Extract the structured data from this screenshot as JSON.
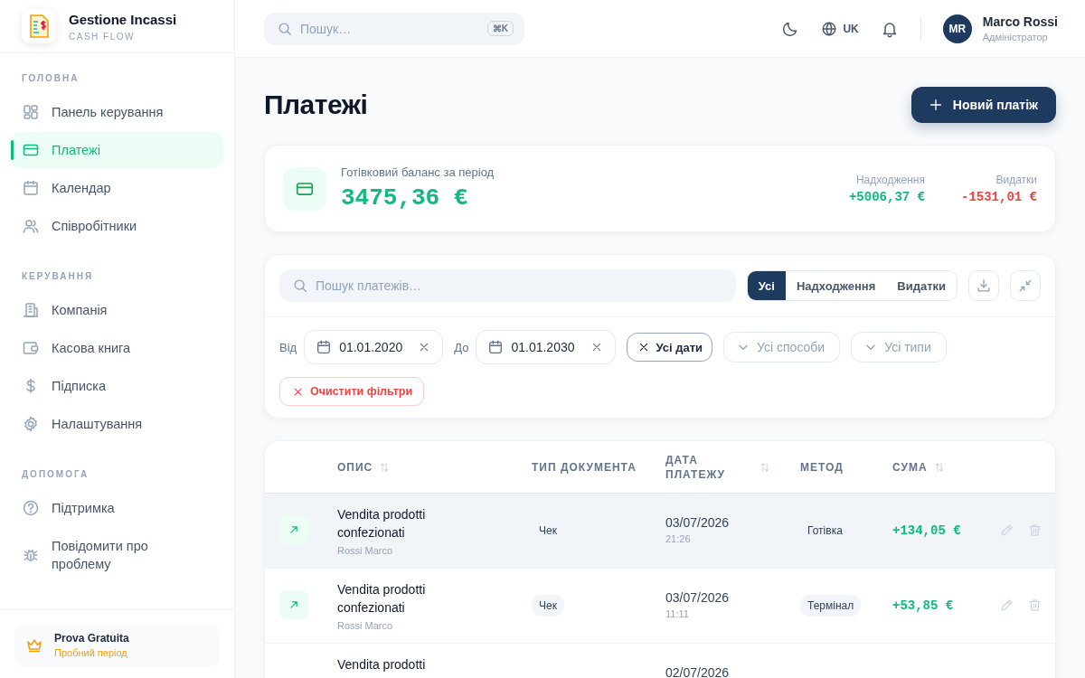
{
  "app": {
    "name": "Gestione Incassi",
    "tagline": "CASH FLOW"
  },
  "sidebar": {
    "sections": [
      {
        "title": "ГОЛОВНА",
        "items": [
          {
            "label": "Панель керування",
            "selected": false
          },
          {
            "label": "Платежі",
            "selected": true
          },
          {
            "label": "Календар",
            "selected": false
          },
          {
            "label": "Співробітники",
            "selected": false
          }
        ]
      },
      {
        "title": "КЕРУВАННЯ",
        "items": [
          {
            "label": "Компанія",
            "selected": false
          },
          {
            "label": "Касова книга",
            "selected": false
          },
          {
            "label": "Підписка",
            "selected": false
          },
          {
            "label": "Налаштування",
            "selected": false
          }
        ]
      },
      {
        "title": "ДОПОМОГА",
        "items": [
          {
            "label": "Підтримка",
            "selected": false
          },
          {
            "label": "Повідомити про проблему",
            "selected": false
          }
        ]
      }
    ],
    "trial": {
      "title": "Prova Gratuita",
      "subtitle": "Пробний період"
    }
  },
  "header": {
    "search": {
      "placeholder": "Пошук…",
      "shortcut": "⌘K"
    },
    "language": "UK",
    "user": {
      "initials": "MR",
      "name": "Marco Rossi",
      "role": "Адміністратор"
    }
  },
  "page": {
    "title": "Платежі",
    "new_button": "Новий платіж"
  },
  "balance": {
    "label": "Готівковий баланс за період",
    "value": "3475,36 €",
    "income_label": "Надходження",
    "income": "+5006,37 €",
    "expense_label": "Видатки",
    "expense": "-1531,01 €"
  },
  "filters": {
    "search": {
      "placeholder": "Пошук платежів…"
    },
    "segments": [
      {
        "label": "Усі",
        "selected": true
      },
      {
        "label": "Надходження",
        "selected": false
      },
      {
        "label": "Видатки",
        "selected": false
      }
    ],
    "from_label": "Від",
    "from": "01.01.2020",
    "to_label": "До",
    "to": "01.01.2030",
    "chips": [
      {
        "label": "Усі дати",
        "kind": "active"
      },
      {
        "label": "Усі способи",
        "kind": "dropdown"
      },
      {
        "label": "Усі типи",
        "kind": "dropdown"
      }
    ],
    "clear": "Очистити фільтри"
  },
  "table": {
    "columns": [
      {
        "label": "ОПИС",
        "sortable": true
      },
      {
        "label": "ТИП ДОКУМЕНТА",
        "sortable": false
      },
      {
        "label": "ДАТА ПЛАТЕЖУ",
        "sortable": true
      },
      {
        "label": "МЕТОД",
        "sortable": false
      },
      {
        "label": "СУМА",
        "sortable": true
      }
    ],
    "rows": [
      {
        "description": "Vendita prodotti confezionati",
        "author": "Rossi Marco",
        "doc_type": "Чек",
        "date": "03/07/2026",
        "time": "21:26",
        "method": "Готівка",
        "amount": "+134,05 €",
        "selected": true
      },
      {
        "description": "Vendita prodotti confezionati",
        "author": "Rossi Marco",
        "doc_type": "Чек",
        "date": "03/07/2026",
        "time": "11:11",
        "method": "Термінал",
        "amount": "+53,85 €",
        "selected": false
      },
      {
        "description": "Vendita prodotti",
        "date": "02/07/2026",
        "selected": false
      }
    ]
  }
}
